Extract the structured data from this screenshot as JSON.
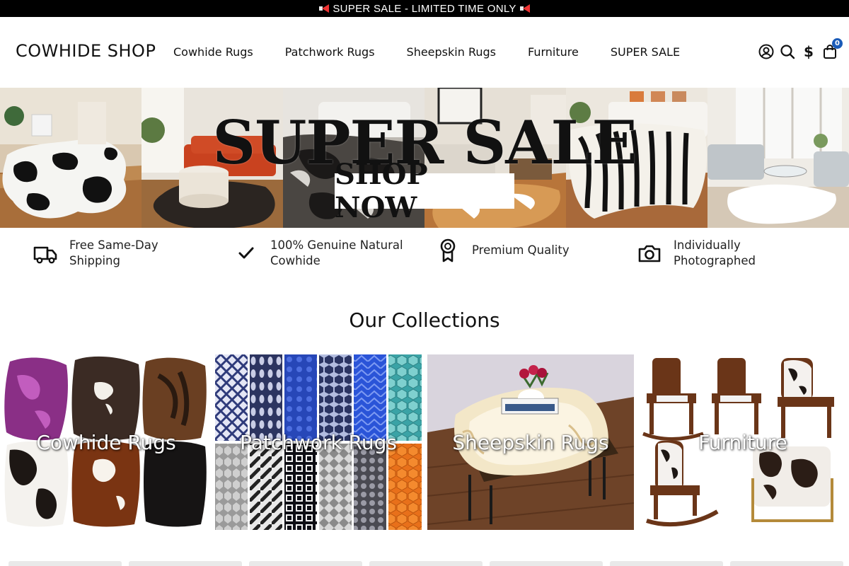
{
  "announcement": {
    "text": "SUPER SALE - LIMITED TIME ONLY",
    "icon": "megaphone-icon"
  },
  "header": {
    "logo": "COWHIDE SHOP",
    "nav": [
      {
        "label": "Cowhide Rugs"
      },
      {
        "label": "Patchwork Rugs"
      },
      {
        "label": "Sheepskin Rugs"
      },
      {
        "label": "Furniture"
      },
      {
        "label": "SUPER SALE"
      }
    ],
    "currency_symbol": "$",
    "cart_count": "0",
    "icons": [
      "account-icon",
      "search-icon",
      "currency-icon",
      "cart-icon"
    ],
    "badge_color": "#1a5bb8"
  },
  "hero": {
    "title": "SUPER SALE",
    "button": "SHOP NOW"
  },
  "features": [
    {
      "text": "Free Same-Day Shipping",
      "icon": "truck-icon"
    },
    {
      "text": "100% Genuine Natural Cowhide",
      "icon": "check-icon"
    },
    {
      "text": "Premium Quality",
      "icon": "award-ribbon-icon"
    },
    {
      "text": "Individually Photographed",
      "icon": "camera-icon"
    }
  ],
  "collections": {
    "title": "Our Collections",
    "items": [
      {
        "label": "Cowhide Rugs"
      },
      {
        "label": "Patchwork Rugs"
      },
      {
        "label": "Sheepskin Rugs"
      },
      {
        "label": "Furniture"
      }
    ]
  }
}
